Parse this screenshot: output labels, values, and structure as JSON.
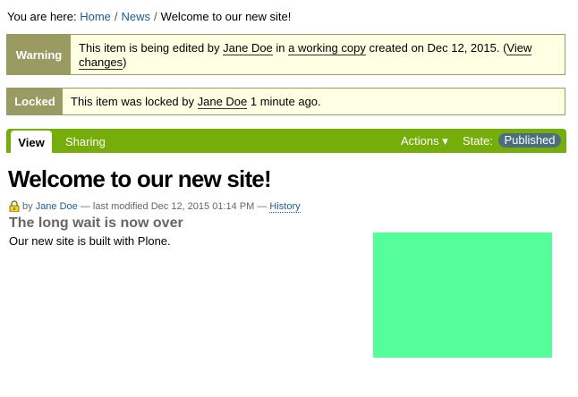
{
  "breadcrumbs": {
    "prefix": "You are here:",
    "items": [
      "Home",
      "News"
    ],
    "separator": "/",
    "current": "Welcome to our new site!"
  },
  "warning": {
    "label": "Warning",
    "text_1": "This item is being edited by ",
    "user": "Jane Doe",
    "text_2": " in ",
    "working_copy": "a working copy",
    "text_3": " created on Dec 12, 2015. (",
    "view_changes": "View changes",
    "text_4": ")"
  },
  "locked": {
    "label": "Locked",
    "text_1": "This item was locked by ",
    "user": "Jane Doe",
    "text_2": " 1 minute ago."
  },
  "toolbar": {
    "tabs": [
      "View",
      "Sharing"
    ],
    "actions_label": "Actions ▾",
    "state_label": "State:",
    "state_value": "Published",
    "accent_color": "#75ad0a",
    "state_badge_color": "#4c6d7d"
  },
  "content": {
    "title": "Welcome to our new site!",
    "byline_prefix": "by",
    "author": "Jane Doe",
    "modified_text": "— last modified Dec 12, 2015 01:14 PM —",
    "history_label": "History",
    "description": "The long wait is now over",
    "body": "Our new site is built with Plone.",
    "image_color": "#55fd9b"
  },
  "icons": {
    "lock": "lock-icon",
    "actions_dropdown": "triangle-down"
  }
}
